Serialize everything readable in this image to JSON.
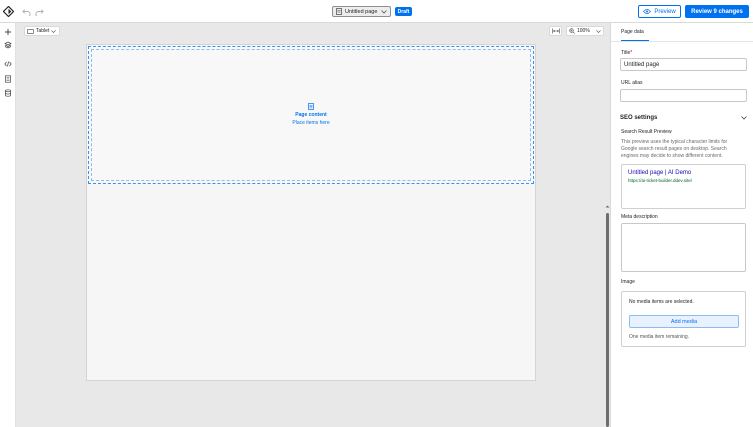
{
  "header": {
    "page_name": "Untitled page",
    "status_badge": "Draft",
    "preview_label": "Preview",
    "review_label": "Review 9 changes"
  },
  "canvas": {
    "device_label": "Tablet",
    "zoom_label": "100%",
    "dropzone_title": "Page content",
    "dropzone_hint": "Place items here"
  },
  "sidebar": {
    "tab_label": "Page data",
    "title_label": "Title",
    "title_required_mark": "*",
    "title_value": "Untitled page",
    "url_alias_label": "URL alias",
    "url_alias_value": "",
    "seo_heading": "SEO settings",
    "serp_heading": "Search Result Preview",
    "serp_description": "This preview uses the typical character limits for Google search result pages on desktop. Search engines may decide to show different content.",
    "serp_title": "Untitled page | AI Demo",
    "serp_url": "https://ai-ticket-builder.ddev.site/",
    "meta_description_label": "Meta description",
    "image_label": "Image",
    "no_media_text": "No media items are selected.",
    "add_media_label": "Add media",
    "media_remaining_text": "One media item remaining."
  },
  "colors": {
    "accent": "#0072ef",
    "canvas_bg": "#e8e8e8",
    "link_title": "#1a0dab",
    "link_url": "#006621"
  },
  "icons": [
    "logo-icon",
    "undo-icon",
    "redo-icon",
    "page-icon",
    "chevron-down-icon",
    "eye-icon",
    "plus-icon",
    "layers-icon",
    "code-icon",
    "document-icon",
    "database-icon",
    "tablet-icon",
    "fit-width-icon",
    "zoom-icon",
    "chevron-up-icon"
  ]
}
